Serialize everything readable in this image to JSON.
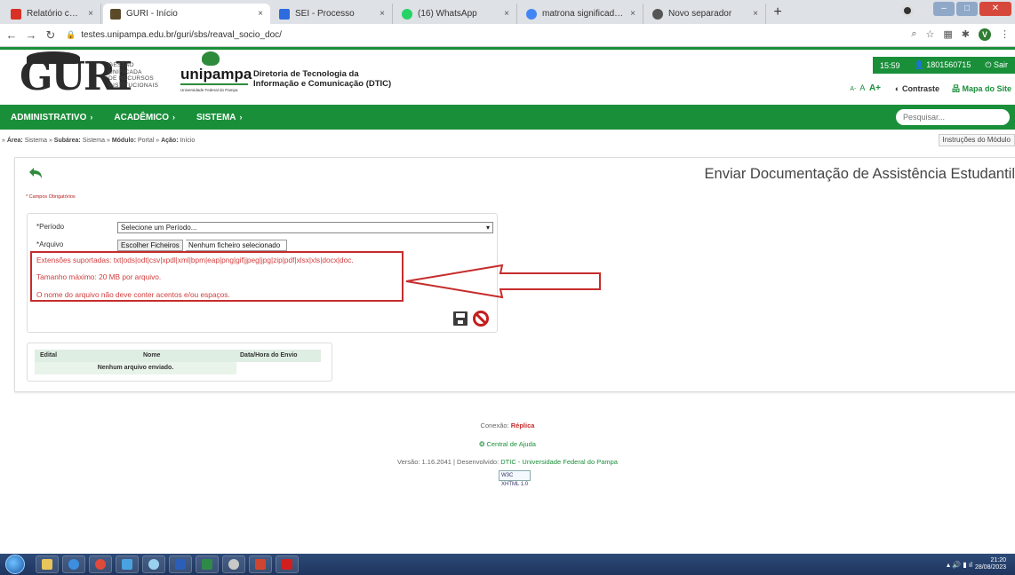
{
  "browser": {
    "tabs": [
      {
        "label": "Relatório com as rendas - vanusa",
        "active": false,
        "fav_color": "#d93025"
      },
      {
        "label": "GURI - Início",
        "active": true,
        "fav_color": "#5a4a2a"
      },
      {
        "label": "SEI - Processo",
        "active": false,
        "fav_color": "#2d6cdf"
      },
      {
        "label": "(16) WhatsApp",
        "active": false,
        "fav_color": "#25d366"
      },
      {
        "label": "matrona significado - Pesquisa G",
        "active": false,
        "fav_color": "#4285f4"
      },
      {
        "label": "Novo separador",
        "active": false,
        "fav_color": "#555555"
      }
    ],
    "tab_close": "×",
    "new_tab": "+",
    "url": "testes.unipampa.edu.br/guri/sbs/reaval_socio_doc/",
    "profile_letter": "V"
  },
  "header": {
    "logo_text": "GURI",
    "logo_sub": [
      "GESTÃO",
      "UNIFICADA",
      "DE RECURSOS",
      "INSTITUCIONAIS"
    ],
    "unipampa_word": "unipampa",
    "unipampa_sub": "Universidade Federal do Pampa",
    "dtic_line1": "Diretoria de Tecnologia da",
    "dtic_line2": "Informação e Comunicação (DTIC)",
    "time": "15:59",
    "user": "1801560715",
    "logout": "Sair",
    "font_small": "A-",
    "font_normal": "A",
    "font_large": "A+",
    "contrast": "Contraste",
    "sitemap": "Mapa do Site"
  },
  "menu": {
    "items": [
      "ADMINISTRATIVO",
      "ACADÊMICO",
      "SISTEMA"
    ],
    "search_placeholder": "Pesquisar..."
  },
  "breadcrumb": {
    "area_label": "Área:",
    "area": "Sistema",
    "subarea_label": "Subárea:",
    "subarea": "Sistema",
    "modulo_label": "Módulo:",
    "modulo": "Portal",
    "acao_label": "Ação:",
    "acao": "Início",
    "instructions": "Instruções do Módulo"
  },
  "page": {
    "title": "Enviar Documentação de Assistência Estudantil",
    "required_note": "* Campos Obrigatórios",
    "periodo_label": "*Período",
    "periodo_value": "Selecione um Período...",
    "arquivo_label": "*Arquivo",
    "file_button": "Escolher Ficheiros",
    "file_status": "Nenhum ficheiro selecionado",
    "info_extensions": "Extensões suportadas: txt|ods|odt|csv|xpdl|xml|bpm|eap|png|gif|jpeg|jpg|zip|pdf|xlsx|xls|docx|doc.",
    "info_size": "Tamanho máximo: 20 MB por arquivo.",
    "info_name": "O nome do arquivo não deve conter acentos e/ou espaços."
  },
  "table": {
    "headers": [
      "Edital",
      "Nome",
      "Data/Hora do Envio"
    ],
    "empty_message": "Nenhum arquivo enviado."
  },
  "footer": {
    "connection_label": "Conexão:",
    "connection_value": "Réplica",
    "help": "Central de Ajuda",
    "version_text": "Versão: 1.16.2041 | Desenvolvido:",
    "developer": "DTIC - Universidade Federal do Pampa",
    "w3c": "W3C XHTML 1.0"
  },
  "taskbar": {
    "time": "21:20",
    "date": "28/08/2023"
  },
  "colors": {
    "brand_green": "#1a8f3a",
    "alert_red": "#c62c2c"
  }
}
